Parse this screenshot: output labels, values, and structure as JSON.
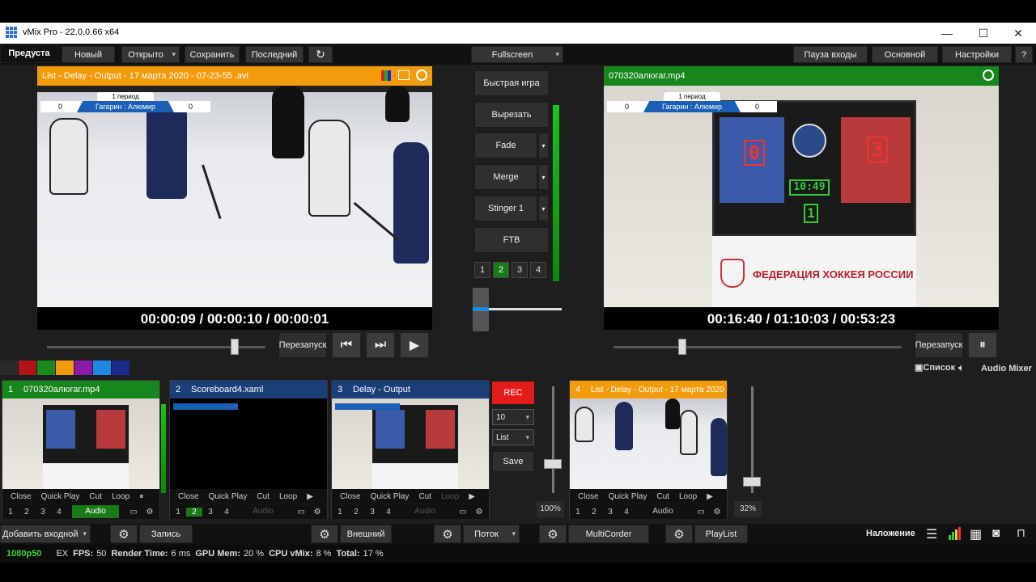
{
  "window": {
    "title": "vMix Pro - 22.0.0.66 x64",
    "minimize": "—",
    "maximize": "☐",
    "close": "✕"
  },
  "toolbar": {
    "tab_preview": "Предуста",
    "new": "Новый",
    "open": "Открыто",
    "save": "Сохранить",
    "last": "Последний",
    "fullscreen": "Fullscreen",
    "pause_inputs": "Пауза входы",
    "main": "Основной",
    "settings": "Настройки",
    "help": "?"
  },
  "preview": {
    "title": "List - Delay - Output - 17 марта 2020 - 07-23-55 .avi",
    "header_color": "#f29b0c",
    "timecode": "00:00:09 / 00:00:10 / 00:00:01",
    "restart": "Перезапуск"
  },
  "output": {
    "title": "070320алюгаг.mp4",
    "header_color": "#17861c",
    "timecode": "00:16:40 / 01:10:03 / 00:53:23",
    "restart": "Перезапуск",
    "federation": "ФЕДЕРАЦИЯ ХОККЕЯ РОССИИ",
    "clock": "10:49",
    "score_home": "0",
    "score_away": "3",
    "period": "1"
  },
  "scorebug": {
    "period": "1 период",
    "teams": "Гагарин : Алюмир",
    "home": "0",
    "away": "0"
  },
  "transitions": {
    "quick_play": "Быстрая игра",
    "cut": "Вырезать",
    "fade": "Fade",
    "merge": "Merge",
    "stinger": "Stinger 1",
    "ftb": "FTB",
    "numbers": [
      "1",
      "2",
      "3",
      "4"
    ]
  },
  "colors": {
    "swatches": [
      "#2a2a2a",
      "#b01515",
      "#1c8a1c",
      "#f29b0c",
      "#8c1aa8",
      "#1e88e5",
      "#1c2a8c"
    ]
  },
  "lists": {
    "list": "Список",
    "audio_mixer": "Audio Mixer"
  },
  "inputs": [
    {
      "num": "1",
      "title": "070320алюгаг.mp4",
      "color": "#17861c",
      "controls": [
        "Close",
        "Quick Play",
        "Cut",
        "Loop"
      ],
      "audio": "Audio"
    },
    {
      "num": "2",
      "title": "Scoreboard4.xaml",
      "color": "#1c3f7a",
      "controls": [
        "Close",
        "Quick Play",
        "Cut",
        "Loop"
      ],
      "audio": "Audio"
    },
    {
      "num": "3",
      "title": "Delay - Output",
      "color": "#1c3f7a",
      "controls": [
        "Close",
        "Quick Play",
        "Cut",
        "Loop"
      ],
      "audio": "Audio"
    },
    {
      "num": "4",
      "title": "List - Delay - Output - 17 марта 2020",
      "color": "#f29b0c",
      "controls": [
        "Close",
        "Quick Play",
        "Cut",
        "Loop"
      ],
      "audio": "Audio"
    }
  ],
  "replay": {
    "rec": "REC",
    "seconds": "10",
    "mode": "List",
    "save": "Save",
    "vol1": "100%",
    "vol2": "32%"
  },
  "bottom": {
    "add_input": "Добавить входной",
    "record": "Запись",
    "external": "Внешний",
    "stream": "Поток",
    "multicorder": "MultiCorder",
    "playlist": "PlayList",
    "overlay": "Наложение"
  },
  "status": {
    "resolution": "1080p50",
    "ex": "EX",
    "fps_label": "FPS:",
    "fps": "50",
    "render_label": "Render Time:",
    "render": "6 ms",
    "gpu_label": "GPU Mem:",
    "gpu": "20 %",
    "cpu_label": "CPU vMix:",
    "cpu": "8 %",
    "total_label": "Total:",
    "total": "17 %"
  }
}
